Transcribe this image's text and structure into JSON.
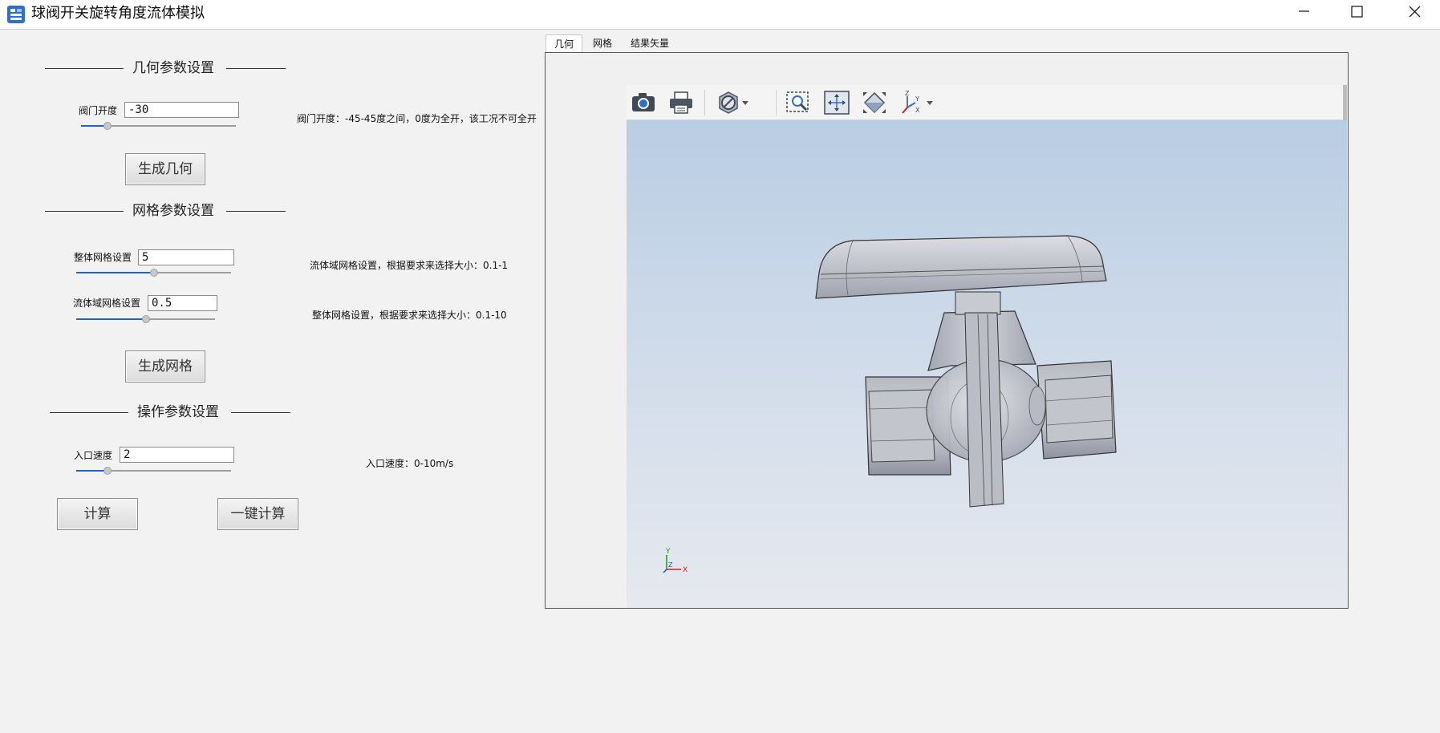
{
  "window": {
    "title": "球阀开关旋转角度流体模拟",
    "icon": "app-icon"
  },
  "geometry": {
    "section_title": "几何参数设置",
    "valve_opening_label": "阀门开度",
    "valve_opening_value": "-30",
    "valve_opening_slider": 0.17,
    "valve_opening_hint": "阀门开度：-45-45度之间，0度为全开，该工况不可全开",
    "generate_button": "生成几何"
  },
  "mesh": {
    "section_title": "网格参数设置",
    "global_label": "整体网格设置",
    "global_value": "5",
    "global_slider": 0.5,
    "global_hint": "流体域网格设置，根据要求来选择大小：0.1-1",
    "fluid_label": "流体域网格设置",
    "fluid_value": "0.5",
    "fluid_slider": 0.5,
    "fluid_hint": "整体网格设置，根据要求来选择大小：0.1-10",
    "generate_button": "生成网格"
  },
  "operation": {
    "section_title": "操作参数设置",
    "inlet_label": "入口速度",
    "inlet_value": "2",
    "inlet_slider": 0.2,
    "inlet_hint": "入口速度：0-10m/s",
    "calc_button": "计算",
    "one_click_button": "一键计算"
  },
  "tabs": [
    {
      "label": "几何",
      "active": true
    },
    {
      "label": "网格",
      "active": false
    },
    {
      "label": "结果矢量",
      "active": false
    }
  ],
  "viewer": {
    "toolbar": [
      "camera-icon",
      "print-icon",
      "display-mode-icon",
      "zoom-box-icon",
      "fit-all-icon",
      "view-iso-icon",
      "axis-triad-icon"
    ],
    "triad": {
      "x": "X",
      "y": "Y",
      "z": "Z"
    },
    "colors": {
      "accent": "#1e64c8",
      "bg_top": "#b9cde4",
      "bg_bottom": "#e6e9ef"
    }
  }
}
